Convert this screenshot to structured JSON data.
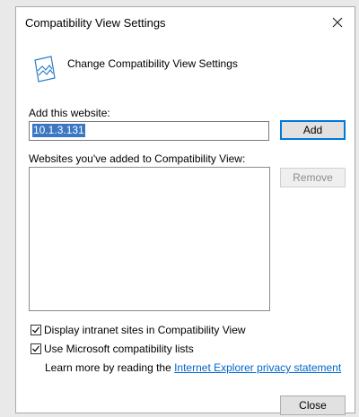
{
  "dialog": {
    "title": "Compatibility View Settings",
    "header": "Change Compatibility View Settings"
  },
  "add_section": {
    "label": "Add this website:",
    "input_value": "10.1.3.131",
    "add_button": "Add"
  },
  "list_section": {
    "label": "Websites you've added to Compatibility View:",
    "remove_button": "Remove",
    "items": []
  },
  "options": {
    "intranet": {
      "label": "Display intranet sites in Compatibility View",
      "checked": true
    },
    "ms_lists": {
      "label": "Use Microsoft compatibility lists",
      "checked": true
    }
  },
  "learn_more": {
    "prefix": "Learn more by reading the ",
    "link_text": "Internet Explorer privacy statement"
  },
  "footer": {
    "close_button": "Close"
  },
  "icons": {
    "header": "compatibility-page-icon",
    "close": "close-icon",
    "check": "checkmark-icon"
  },
  "colors": {
    "accent": "#0078d7",
    "selection": "#3b77c3",
    "link": "#0066cc"
  }
}
